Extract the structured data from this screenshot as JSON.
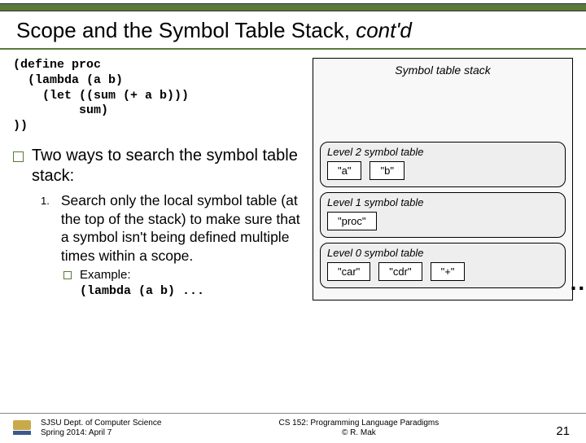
{
  "title_main": "Scope and the Symbol Table Stack, ",
  "title_italic": "cont'd",
  "code": "(define proc\n  (lambda (a b)\n    (let ((sum (+ a b)))\n         sum)\n))",
  "main_bullet": "Two ways to search the symbol table stack:",
  "sub1_num": "1.",
  "sub1_text": "Search only the local symbol table (at the top of the stack) to make sure that a symbol isn't being defined multiple times within a scope.",
  "subsub_label": "Example:",
  "subsub_code": "(lambda (a b) ...",
  "stack": {
    "title": "Symbol table stack",
    "levels": [
      {
        "label": "Level 2 symbol table",
        "symbols": [
          "\"a\"",
          "\"b\""
        ]
      },
      {
        "label": "Level 1 symbol table",
        "symbols": [
          "\"proc\""
        ]
      },
      {
        "label": "Level 0 symbol table",
        "symbols": [
          "\"car\"",
          "\"cdr\"",
          "\"+\""
        ]
      }
    ],
    "ellipsis": "..."
  },
  "footer": {
    "left1": "SJSU Dept. of Computer Science",
    "left2": "Spring 2014: April 7",
    "center1": "CS 152: Programming Language Paradigms",
    "center2": "© R. Mak",
    "page": "21"
  }
}
